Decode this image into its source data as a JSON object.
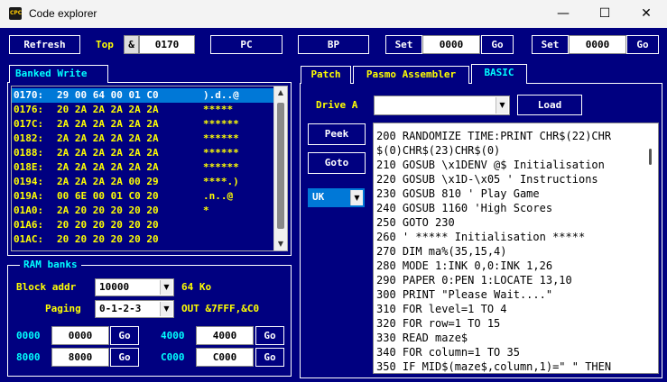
{
  "window": {
    "title": "Code explorer",
    "app_icon": "cpc-icon"
  },
  "toolbar": {
    "refresh": "Refresh",
    "top_label": "Top",
    "amp": "&",
    "top_value": "0170",
    "pc": "PC",
    "bp": "BP",
    "set1_label": "Set",
    "set1_value": "0000",
    "go1": "Go",
    "set2_label": "Set",
    "set2_value": "0000",
    "go2": "Go"
  },
  "left": {
    "tab_label": "Banked Write",
    "rows": [
      {
        "addr": "0170:",
        "bytes": "29 00 64 00 01 C0",
        "ascii": ").d..@"
      },
      {
        "addr": "0176:",
        "bytes": "20 2A 2A 2A 2A 2A",
        "ascii": "*****"
      },
      {
        "addr": "017C:",
        "bytes": "2A 2A 2A 2A 2A 2A",
        "ascii": "******"
      },
      {
        "addr": "0182:",
        "bytes": "2A 2A 2A 2A 2A 2A",
        "ascii": "******"
      },
      {
        "addr": "0188:",
        "bytes": "2A 2A 2A 2A 2A 2A",
        "ascii": "******"
      },
      {
        "addr": "018E:",
        "bytes": "2A 2A 2A 2A 2A 2A",
        "ascii": "******"
      },
      {
        "addr": "0194:",
        "bytes": "2A 2A 2A 2A 00 29",
        "ascii": "****.)"
      },
      {
        "addr": "019A:",
        "bytes": "00 6E 00 01 C0 20",
        "ascii": ".n..@"
      },
      {
        "addr": "01A0:",
        "bytes": "2A 20 20 20 20 20",
        "ascii": "*"
      },
      {
        "addr": "01A6:",
        "bytes": "20 20 20 20 20 20",
        "ascii": ""
      },
      {
        "addr": "01AC:",
        "bytes": "20 20 20 20 20 20",
        "ascii": ""
      }
    ]
  },
  "ram": {
    "group_label": "RAM banks",
    "block_label": "Block addr",
    "block_value": "10000",
    "block_size": "64 Ko",
    "paging_label": "Paging",
    "paging_value": "0-1-2-3",
    "out_text": "OUT &7FFF,&C0",
    "banks": [
      {
        "label": "0000",
        "value": "0000",
        "go": "Go"
      },
      {
        "label": "4000",
        "value": "4000",
        "go": "Go"
      },
      {
        "label": "8000",
        "value": "8000",
        "go": "Go"
      },
      {
        "label": "C000",
        "value": "C000",
        "go": "Go"
      }
    ]
  },
  "right": {
    "tabs": [
      "Patch",
      "Pasmo Assembler",
      "BASIC"
    ],
    "drive_label": "Drive A",
    "drive_value": "",
    "load": "Load",
    "peek": "Peek",
    "goto": "Goto",
    "lang": "UK",
    "basic_lines": [
      "200 RANDOMIZE TIME:PRINT CHR$(22)CHR",
      "$(0)CHR$(23)CHR$(0)",
      "210 GOSUB \\x1DENV @$ Initialisation",
      "220 GOSUB \\x1D-\\x05 ' Instructions",
      "230 GOSUB 810 ' Play Game",
      "240 GOSUB 1160 'High Scores",
      "250 GOTO 230",
      "260 ' ***** Initialisation *****",
      "270 DIM ma%(35,15,4)",
      "280 MODE 1:INK 0,0:INK 1,26",
      "290 PAPER 0:PEN 1:LOCATE 13,10",
      "300 PRINT \"Please Wait....\"",
      "310 FOR level=1 TO 4",
      "320 FOR row=1 TO 15",
      "330 READ maze$",
      "340 FOR column=1 TO 35",
      "350 IF MID$(maze$,column,1)=\" \" THEN"
    ]
  }
}
